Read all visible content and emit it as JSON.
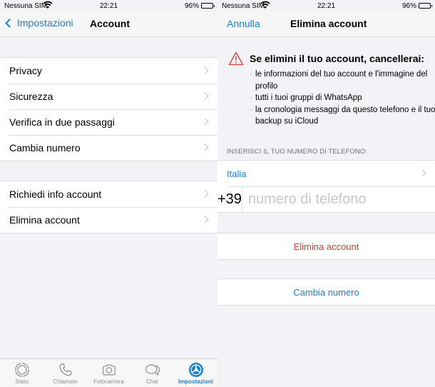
{
  "status_bar": {
    "carrier": "Nessuna SIM",
    "time": "22:21",
    "battery_percent": "96%"
  },
  "left_screen": {
    "nav": {
      "back_label": "Impostazioni",
      "title": "Account"
    },
    "groups": [
      {
        "items": [
          {
            "label": "Privacy"
          },
          {
            "label": "Sicurezza"
          },
          {
            "label": "Verifica in due passaggi"
          },
          {
            "label": "Cambia numero"
          }
        ]
      },
      {
        "items": [
          {
            "label": "Richiedi info account"
          },
          {
            "label": "Elimina account"
          }
        ]
      }
    ],
    "tabbar": {
      "tabs": [
        {
          "label": "Stato",
          "icon": "status-icon",
          "active": false
        },
        {
          "label": "Chiamate",
          "icon": "phone-icon",
          "active": false
        },
        {
          "label": "Fotocamera",
          "icon": "camera-icon",
          "active": false
        },
        {
          "label": "Chat",
          "icon": "chat-bubbles-icon",
          "active": false
        },
        {
          "label": "Impostazioni",
          "icon": "gear-icon",
          "active": true
        }
      ]
    }
  },
  "right_screen": {
    "nav": {
      "cancel_label": "Annulla",
      "title": "Elimina account"
    },
    "warning": {
      "icon": "warning-triangle-icon",
      "heading": "Se elimini il tuo account, cancellerai:",
      "bullets": [
        "le informazioni del tuo account e l'immagine del profilo",
        "tutti i tuoi gruppi di WhatsApp",
        "la cronologia messaggi da questo telefono e il tuo backup su iCloud"
      ]
    },
    "phone_section": {
      "label": "INSERISCI IL TUO NUMERO DI TELEFONO:",
      "country": "Italia",
      "prefix": "+39",
      "number_value": "",
      "number_placeholder": "numero di telefono"
    },
    "delete_button": "Elimina account",
    "change_number_button": "Cambia numero"
  },
  "colors": {
    "accent": "#1f80c6",
    "destructive": "#d03a2f",
    "background": "#f2f2f7"
  }
}
